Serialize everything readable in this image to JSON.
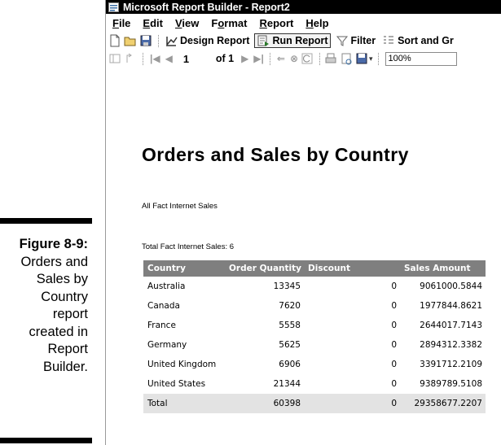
{
  "caption": {
    "figure_label": "Figure 8-9:",
    "lines": [
      "Orders and",
      "Sales by",
      "Country",
      "report",
      "created in",
      "Report",
      "Builder."
    ]
  },
  "window": {
    "title": "Microsoft Report Builder - Report2",
    "menu": [
      "File",
      "Edit",
      "View",
      "Format",
      "Report",
      "Help"
    ],
    "menu_access_keys": [
      "F",
      "E",
      "V",
      "o",
      "R",
      "H"
    ],
    "toolbar": {
      "design_report": "Design Report",
      "run_report": "Run Report",
      "filter": "Filter",
      "sort_and_group": "Sort and Gr"
    },
    "nav": {
      "page_number": "1",
      "of_pages": "of 1",
      "zoom": "100%"
    }
  },
  "report": {
    "title": "Orders and Sales by Country",
    "subtitle": "All Fact Internet Sales",
    "total_line": "Total Fact Internet Sales: 6",
    "columns": [
      "Country",
      "Order Quantity",
      "Discount",
      "",
      "Sales Amount"
    ],
    "rows": [
      [
        "Australia",
        "13345",
        "",
        "0",
        "9061000.5844"
      ],
      [
        "Canada",
        "7620",
        "",
        "0",
        "1977844.8621"
      ],
      [
        "France",
        "5558",
        "",
        "0",
        "2644017.7143"
      ],
      [
        "Germany",
        "5625",
        "",
        "0",
        "2894312.3382"
      ],
      [
        "United Kingdom",
        "6906",
        "",
        "0",
        "3391712.2109"
      ],
      [
        "United States",
        "21344",
        "",
        "0",
        "9389789.5108"
      ]
    ],
    "total_row": [
      "Total",
      "60398",
      "",
      "0",
      "29358677.2207"
    ]
  },
  "colors": {
    "header_bg": "#7f7f7f",
    "total_bg": "#e3e3e3",
    "titlebar_bg": "#000000"
  }
}
